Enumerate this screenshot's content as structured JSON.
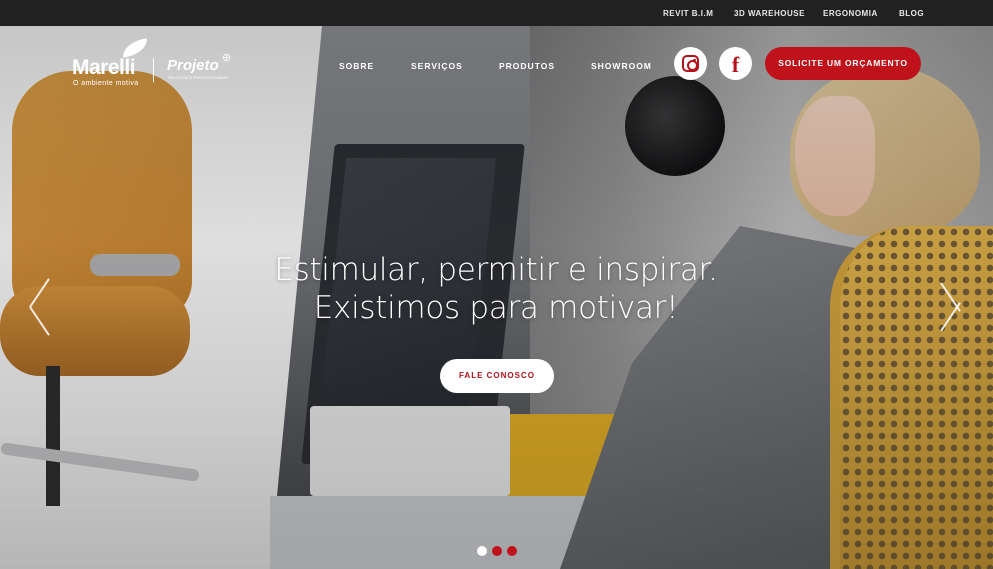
{
  "topbar": {
    "links": [
      {
        "label": "REVIT B.I.M"
      },
      {
        "label": "3D WAREHOUSE"
      },
      {
        "label": "ERGONOMIA"
      },
      {
        "label": "BLOG"
      }
    ]
  },
  "brand": {
    "name": "Marelli",
    "tagline": "O ambiente motiva",
    "partner": "Projeto",
    "partner_sub": "SELEÇÕES PROFISSIONAIS"
  },
  "nav": {
    "items": [
      {
        "label": "SOBRE"
      },
      {
        "label": "SERVIÇOS"
      },
      {
        "label": "PRODUTOS"
      },
      {
        "label": "SHOWROOM"
      }
    ]
  },
  "social": {
    "instagram_icon": "instagram-icon",
    "facebook_icon": "facebook-icon",
    "facebook_glyph": "f"
  },
  "cta": {
    "label": "SOLICITE UM ORÇAMENTO"
  },
  "hero": {
    "headline_line1": "Estimular, permitir e inspirar.",
    "headline_line2": "Existimos para motivar!",
    "button_label": "FALE CONOSCO",
    "prev_icon": "chevron-left-icon",
    "next_icon": "chevron-right-icon",
    "slides_total": 3,
    "active_slide": 1
  },
  "colors": {
    "accent": "#c0121b",
    "topbar": "#212121",
    "text_light": "#ffffff"
  }
}
